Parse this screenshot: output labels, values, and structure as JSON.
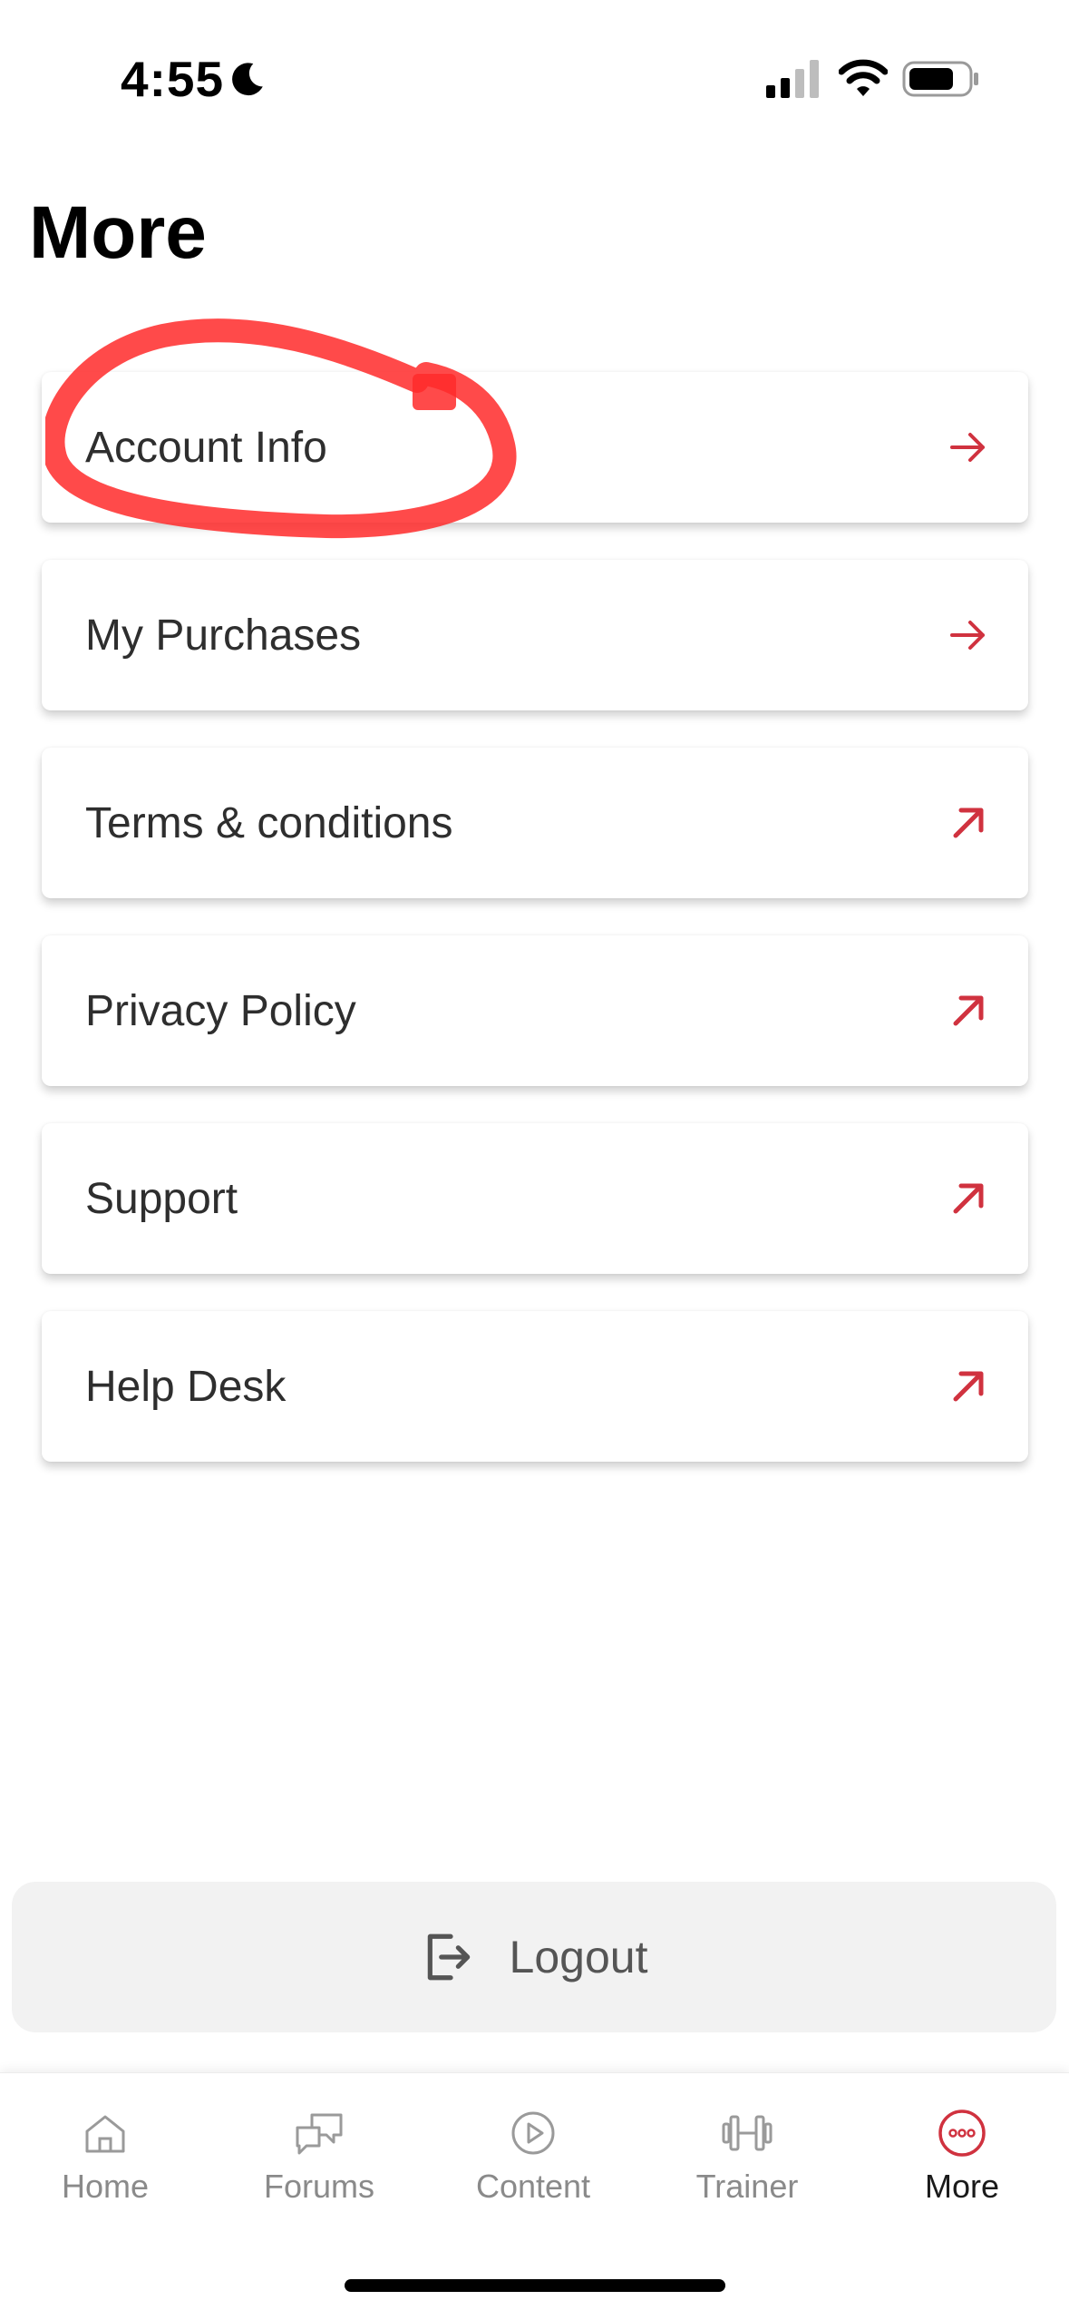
{
  "status_bar": {
    "time": "4:55",
    "icons": [
      "moon-icon",
      "cellular-signal-icon",
      "wifi-icon",
      "battery-icon"
    ]
  },
  "page": {
    "title": "More"
  },
  "menu": {
    "accent_color": "#d0323f",
    "items": [
      {
        "label": "Account Info",
        "icon": "arrow-right-icon"
      },
      {
        "label": "My Purchases",
        "icon": "arrow-right-icon"
      },
      {
        "label": "Terms & conditions",
        "icon": "external-link-arrow-icon"
      },
      {
        "label": "Privacy Policy",
        "icon": "external-link-arrow-icon"
      },
      {
        "label": "Support",
        "icon": "external-link-arrow-icon"
      },
      {
        "label": "Help Desk",
        "icon": "external-link-arrow-icon"
      }
    ]
  },
  "annotation": {
    "type": "red-circle-highlight",
    "target": "Account Info",
    "color": "#ff2a2a"
  },
  "logout": {
    "label": "Logout",
    "icon": "logout-icon"
  },
  "bottom_nav": {
    "items": [
      {
        "label": "Home",
        "icon": "home-icon",
        "active": false
      },
      {
        "label": "Forums",
        "icon": "chat-bubbles-icon",
        "active": false
      },
      {
        "label": "Content",
        "icon": "play-circle-icon",
        "active": false
      },
      {
        "label": "Trainer",
        "icon": "dumbbell-icon",
        "active": false
      },
      {
        "label": "More",
        "icon": "more-dots-icon",
        "active": true
      }
    ],
    "active_color": "#d0323f"
  }
}
